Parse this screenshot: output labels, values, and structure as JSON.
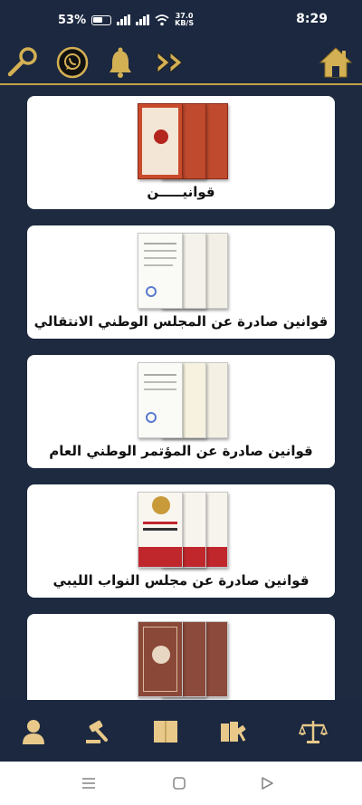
{
  "status_bar": {
    "battery_percent": "53%",
    "net_speed_value": "37.0",
    "net_speed_unit": "KB/S",
    "time": "8:29"
  },
  "top_bar": {
    "icons": [
      "search-icon",
      "whatsapp-icon",
      "bell-icon",
      "fast-forward-icon",
      "home-icon"
    ]
  },
  "cards": [
    {
      "label": "قوانيـــــن",
      "cover": "red-certificate-covers"
    },
    {
      "label": "قوانين صادرة عن المجلس الوطني الانتقالي",
      "cover": "white-document-covers"
    },
    {
      "label": "قوانين صادرة عن المؤتمر الوطني العام",
      "cover": "white-document-covers"
    },
    {
      "label": "قوانين صادرة عن مجلس النواب الليبي",
      "cover": "white-red-booklet-covers"
    },
    {
      "label": "",
      "cover": "brown-booklet-covers"
    }
  ],
  "bottom_nav": {
    "items": [
      "person-icon",
      "gavel-icon",
      "book-icon",
      "books-gavel-icon",
      "scales-icon"
    ]
  },
  "android_nav": {
    "items": [
      "menu-icon",
      "home-square-icon",
      "back-triangle-icon"
    ]
  },
  "colors": {
    "background": "#1d2a3f",
    "accent_gold": "#c5a14a",
    "card": "#ffffff"
  }
}
